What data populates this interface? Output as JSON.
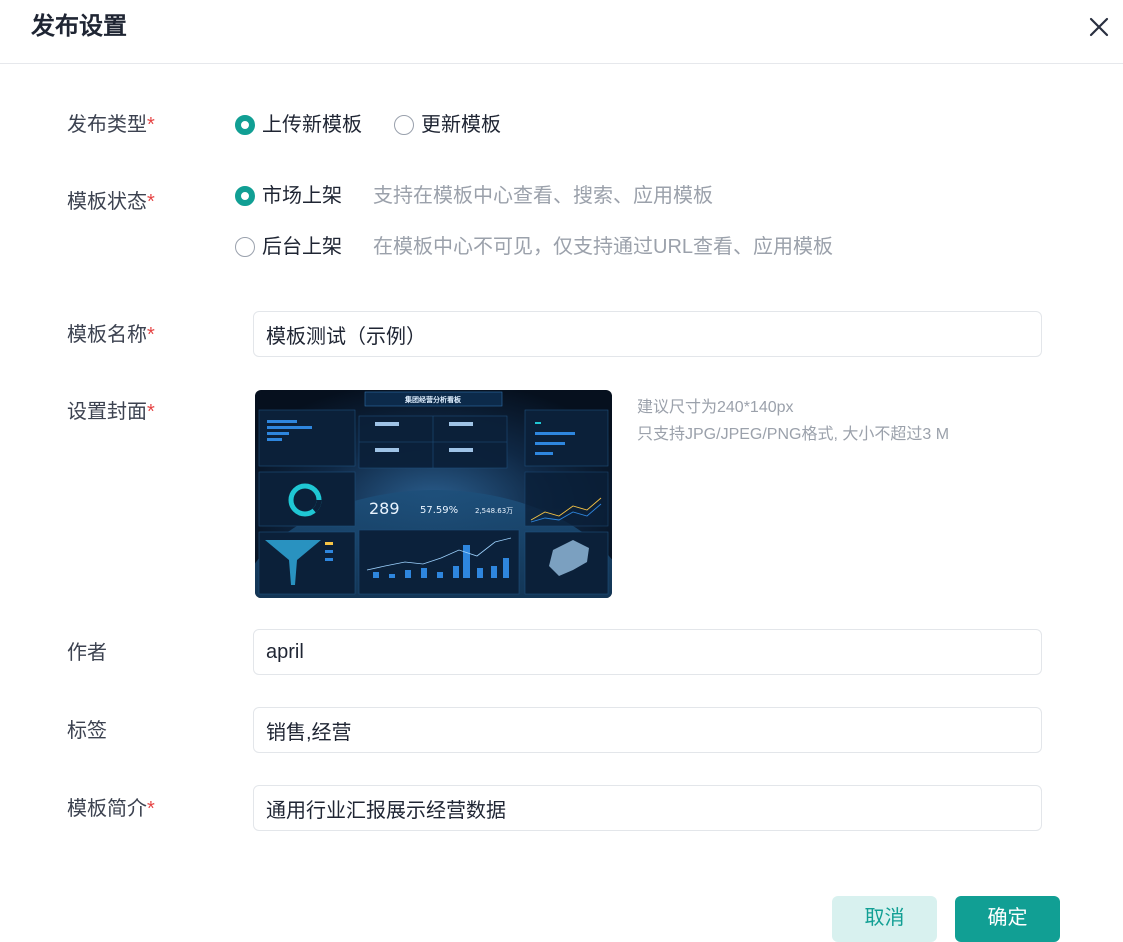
{
  "dialog": {
    "title": "发布设置"
  },
  "fields": {
    "publish_type": {
      "label": "发布类型",
      "options": [
        {
          "label": "上传新模板",
          "selected": true
        },
        {
          "label": "更新模板",
          "selected": false
        }
      ]
    },
    "status": {
      "label": "模板状态",
      "options": [
        {
          "label": "市场上架",
          "hint": "支持在模板中心查看、搜索、应用模板",
          "selected": true
        },
        {
          "label": "后台上架",
          "hint": "在模板中心不可见，仅支持通过URL查看、应用模板",
          "selected": false
        }
      ]
    },
    "name": {
      "label": "模板名称",
      "value": "模板测试（示例）"
    },
    "cover": {
      "label": "设置封面",
      "hint_size": "建议尺寸为240*140px",
      "hint_format": "只支持JPG/JPEG/PNG格式, 大小不超过3 M",
      "image_title": "集团经营分析看板",
      "image_kpis": [
        "289",
        "57.59%",
        "2,548.63万"
      ]
    },
    "author": {
      "label": "作者",
      "value": "april"
    },
    "tags": {
      "label": "标签",
      "value": "销售,经营"
    },
    "summary": {
      "label": "模板简介",
      "value": "通用行业汇报展示经营数据"
    }
  },
  "required_mark": "*",
  "buttons": {
    "cancel": "取消",
    "confirm": "确定"
  },
  "colors": {
    "accent": "#119f94",
    "accent_light": "#d8f1ef",
    "required": "#e64545"
  }
}
